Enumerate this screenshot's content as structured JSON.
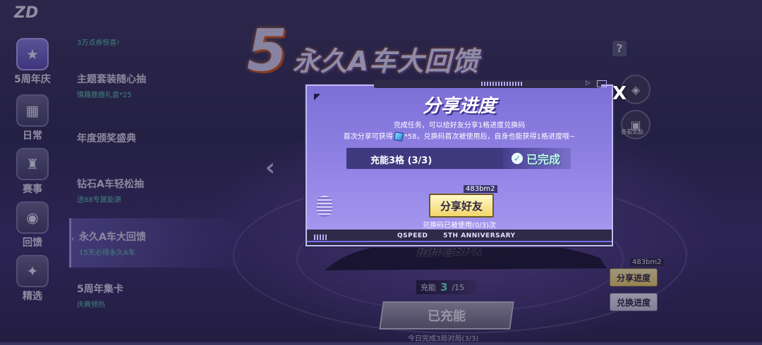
{
  "app": {
    "logo": "ZD"
  },
  "banner": {
    "big_number": "5",
    "title": "永久A车大回馈",
    "help": "?"
  },
  "sidebar": {
    "items": [
      {
        "label": "5周年庆",
        "icon": "gift-box-icon"
      },
      {
        "label": "日常",
        "icon": "calendar-icon"
      },
      {
        "label": "赛事",
        "icon": "trophy-icon"
      },
      {
        "label": "回馈",
        "icon": "feedback-icon"
      },
      {
        "label": "精选",
        "icon": "star-icon"
      }
    ]
  },
  "menu": {
    "items": [
      {
        "title": "",
        "sub": "3万点券惊喜!"
      },
      {
        "title": "主题套装随心抽",
        "sub": "情趣鹿鹿礼盒*25"
      },
      {
        "title": "年度颁奖盛典",
        "sub": ""
      },
      {
        "title": "钻石A车轻松抽",
        "sub": "送88专属能源"
      },
      {
        "title": "永久A车大回馈",
        "sub": "15天必得永久A车"
      },
      {
        "title": "5周年集卡",
        "sub": "庆典预热"
      }
    ]
  },
  "background": {
    "car_name": "指挥官SPX"
  },
  "right_panel": {
    "code": "483bm2",
    "share_progress": "分享进度",
    "exchange_progress": "兑换进度",
    "reward_label": "查看奖励"
  },
  "progress": {
    "label": "充能",
    "current": "3",
    "total": "/15",
    "charged_button": "已充能",
    "today_note": "今日完成3局对局(3/3)"
  },
  "dialog": {
    "title": "分享进度",
    "desc1": "完成任务，可以给好友分享1格进度兑换码",
    "desc2_a": "首次分享可获得",
    "desc2_b": "*58，兑换码首次被使用后，自身也能获得1格进度哦~",
    "task_label": "充能3格 (3/3)",
    "task_status": "已完成",
    "code": "483bm2",
    "share_button": "分享好友",
    "code_used": "兑换码已被使用(0/3)次",
    "footer_left": "QSPEED",
    "footer_right": "5TH ANNIVERSARY",
    "close": "X"
  },
  "colors": {
    "dialog_bg": "#8f80e3",
    "accent_green": "#6ff0c8",
    "button_yellow": "#f6d56a"
  }
}
